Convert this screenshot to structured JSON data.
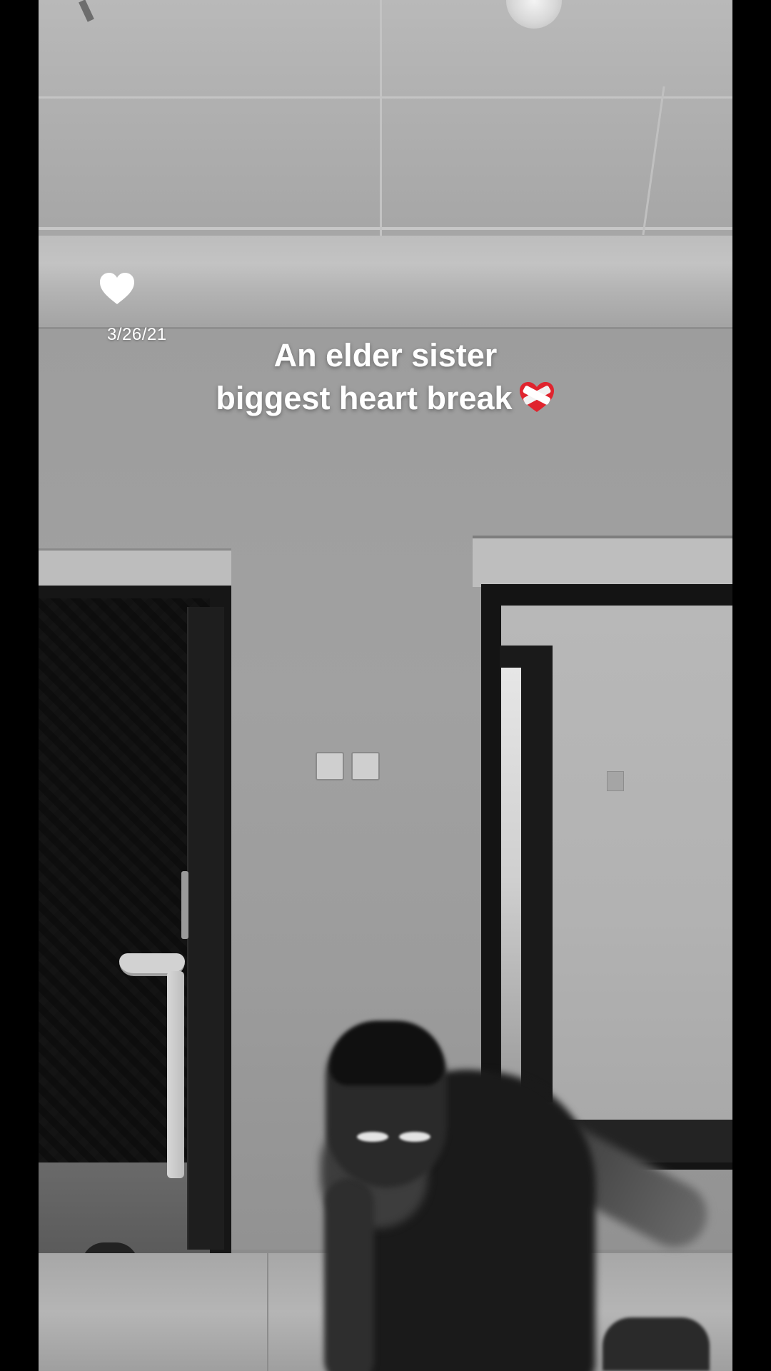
{
  "post": {
    "date": "3/26/21",
    "caption_line_1": "An elder sister",
    "caption_line_2": "biggest heart break",
    "caption_emoji": "mending-heart-icon",
    "heart_icon": "heart-icon"
  },
  "colors": {
    "caption_text": "#ffffff",
    "emoji_red": "#e0242e",
    "letterbox": "#000000"
  }
}
